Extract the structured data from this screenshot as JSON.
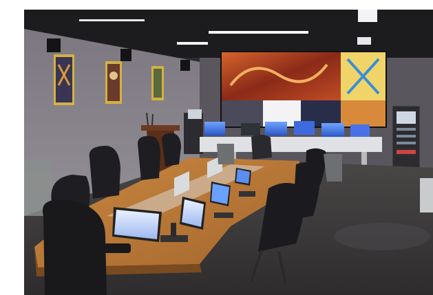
{
  "photo": {
    "subject": "conference-room-control-center",
    "colors": {
      "wall": "#8e8a90",
      "ceiling": "#1c1b1e",
      "floor": "#3d3a3b",
      "table": "#b77a3c",
      "chair": "#1e1e22",
      "video_wall_warm": "#c2542a",
      "screen_glow": "#3b6ee0"
    }
  }
}
